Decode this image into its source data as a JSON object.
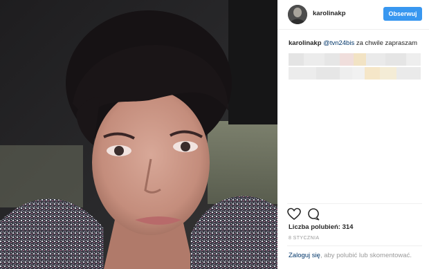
{
  "post": {
    "username": "karolinakp",
    "follow_label": "Obserwuj",
    "caption": {
      "username": "karolinakp",
      "mention": "@tvn24bis",
      "text": " za chwile zapraszam"
    },
    "likes_text": "Liczba polubień: 314",
    "date": "8 STYCZNIA",
    "login_link": "Zaloguj się",
    "login_text": ", aby polubić lub skomentować."
  },
  "icons": {
    "like": "heart-icon",
    "comment": "comment-icon"
  },
  "colors": {
    "follow_button": "#3897f0",
    "link": "#003569",
    "muted": "#999999"
  }
}
